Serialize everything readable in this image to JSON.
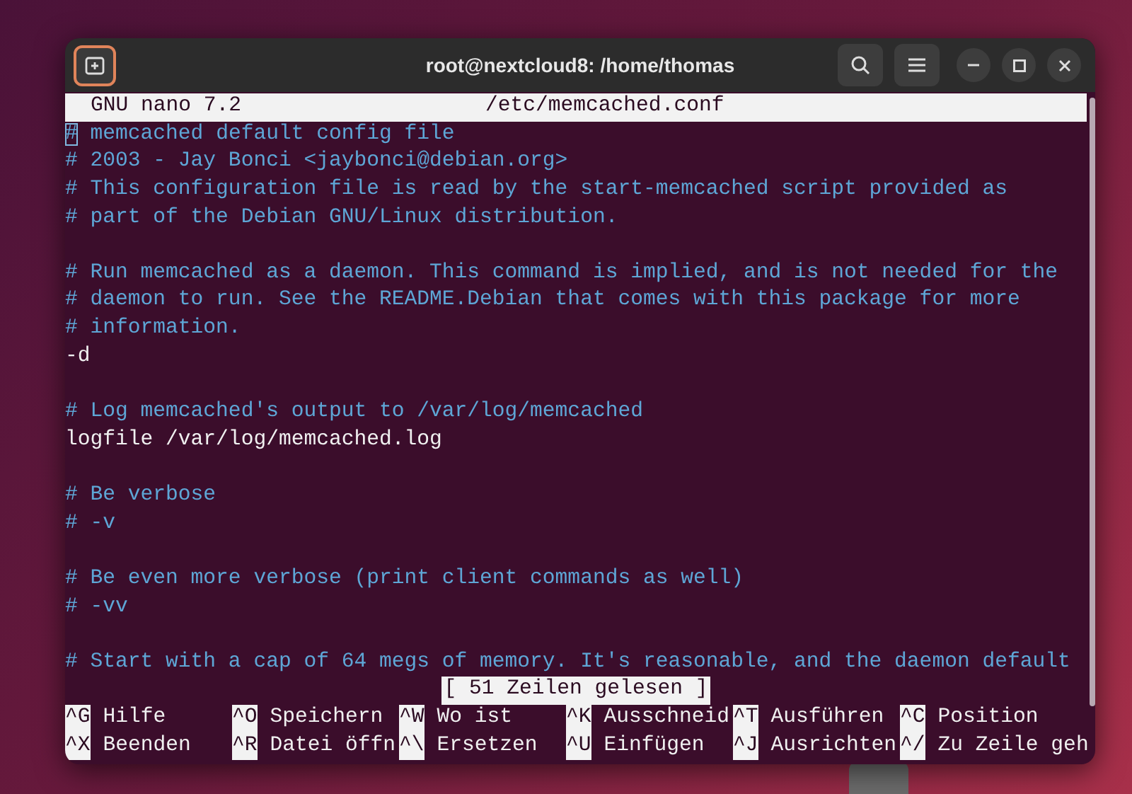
{
  "window": {
    "title": "root@nextcloud8: /home/thomas"
  },
  "nano": {
    "version": "GNU nano 7.2",
    "filename": "/etc/memcached.conf"
  },
  "lines": [
    {
      "kind": "comment",
      "text": "# memcached default config file",
      "cursor": true
    },
    {
      "kind": "comment",
      "text": "# 2003 - Jay Bonci <jaybonci@debian.org>",
      "cursor": false
    },
    {
      "kind": "comment",
      "text": "# This configuration file is read by the start-memcached script provided as",
      "cursor": false
    },
    {
      "kind": "comment",
      "text": "# part of the Debian GNU/Linux distribution.",
      "cursor": false
    },
    {
      "kind": "blank",
      "cursor": false
    },
    {
      "kind": "comment",
      "text": "# Run memcached as a daemon. This command is implied, and is not needed for the",
      "cursor": false
    },
    {
      "kind": "comment",
      "text": "# daemon to run. See the README.Debian that comes with this package for more",
      "cursor": false
    },
    {
      "kind": "comment",
      "text": "# information.",
      "cursor": false
    },
    {
      "kind": "plain",
      "text": "-d",
      "cursor": false
    },
    {
      "kind": "blank",
      "cursor": false
    },
    {
      "kind": "comment",
      "text": "# Log memcached's output to /var/log/memcached",
      "cursor": false
    },
    {
      "kind": "plain",
      "text": "logfile /var/log/memcached.log",
      "cursor": false
    },
    {
      "kind": "blank",
      "cursor": false
    },
    {
      "kind": "comment",
      "text": "# Be verbose",
      "cursor": false
    },
    {
      "kind": "comment",
      "text": "# -v",
      "cursor": false
    },
    {
      "kind": "blank",
      "cursor": false
    },
    {
      "kind": "comment",
      "text": "# Be even more verbose (print client commands as well)",
      "cursor": false
    },
    {
      "kind": "comment",
      "text": "# -vv",
      "cursor": false
    },
    {
      "kind": "blank",
      "cursor": false
    },
    {
      "kind": "comment",
      "text": "# Start with a cap of 64 megs of memory. It's reasonable, and the daemon default",
      "cursor": false
    }
  ],
  "status": "[ 51 Zeilen gelesen ]",
  "shortcuts": [
    [
      {
        "key": "^G",
        "label": "Hilfe"
      },
      {
        "key": "^O",
        "label": "Speichern"
      },
      {
        "key": "^W",
        "label": "Wo ist"
      },
      {
        "key": "^K",
        "label": "Ausschneid"
      },
      {
        "key": "^T",
        "label": "Ausführen"
      },
      {
        "key": "^C",
        "label": "Position"
      }
    ],
    [
      {
        "key": "^X",
        "label": "Beenden"
      },
      {
        "key": "^R",
        "label": "Datei öffn"
      },
      {
        "key": "^\\",
        "label": "Ersetzen"
      },
      {
        "key": "^U",
        "label": "Einfügen"
      },
      {
        "key": "^J",
        "label": "Ausrichten"
      },
      {
        "key": "^/",
        "label": "Zu Zeile geh"
      }
    ]
  ]
}
